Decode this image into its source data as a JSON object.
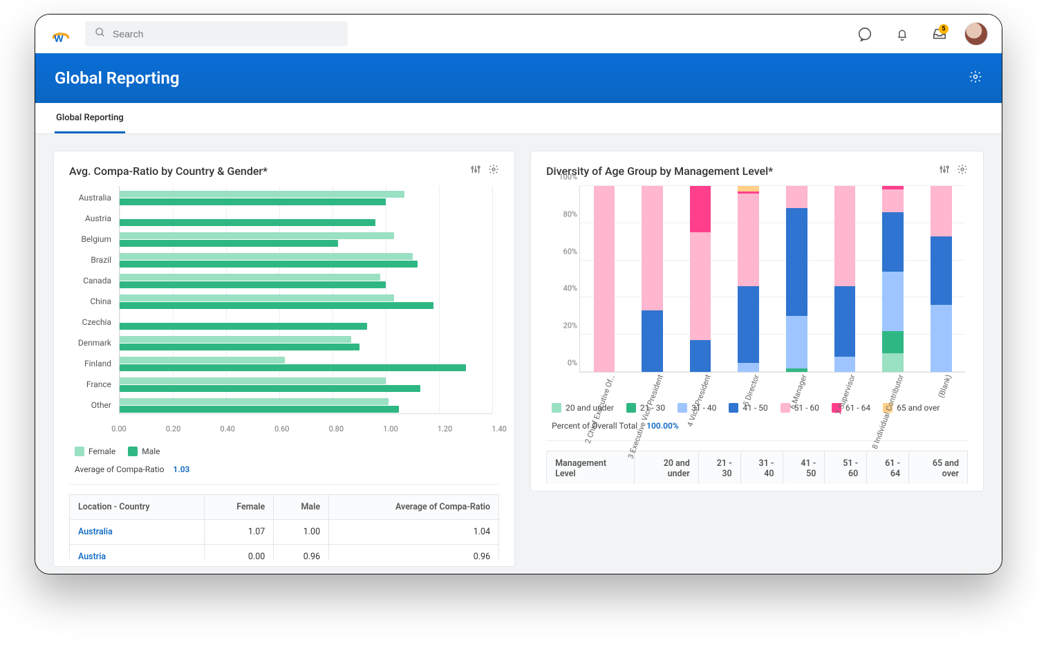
{
  "topbar": {
    "search_placeholder": "Search",
    "inbox_badge": "5"
  },
  "header": {
    "title": "Global Reporting"
  },
  "tabs": [
    "Global Reporting"
  ],
  "left_card": {
    "title": "Avg. Compa-Ratio by Country & Gender*",
    "summary_label": "Average of Compa-Ratio",
    "summary_value": "1.03",
    "legend": [
      "Female",
      "Male"
    ],
    "xticks": [
      "0.00",
      "0.20",
      "0.40",
      "0.60",
      "0.80",
      "1.00",
      "1.20",
      "1.40"
    ],
    "table_headers": [
      "Location - Country",
      "Female",
      "Male",
      "Average of Compa-Ratio"
    ],
    "table_rows": [
      {
        "country": "Australia",
        "female": "1.07",
        "male": "1.00",
        "avg": "1.04"
      },
      {
        "country": "Austria",
        "female": "0.00",
        "male": "0.96",
        "avg": "0.96"
      }
    ]
  },
  "right_card": {
    "title": "Diversity of Age Group by Management Level*",
    "yticks": [
      "0%",
      "20%",
      "40%",
      "60%",
      "80%",
      "100%"
    ],
    "legend": [
      {
        "label": "20 and under",
        "class": "c-20u"
      },
      {
        "label": "21 - 30",
        "class": "c-2130"
      },
      {
        "label": "31 - 40",
        "class": "c-3140"
      },
      {
        "label": "41 - 50",
        "class": "c-4150"
      },
      {
        "label": "51 - 60",
        "class": "c-5160"
      },
      {
        "label": "61 - 64",
        "class": "c-6164"
      },
      {
        "label": "65 and over",
        "class": "c-65o"
      }
    ],
    "summary_label": "Percent of Overall Total",
    "summary_value": "100.00%",
    "table_headers": [
      "Management Level",
      "20 and under",
      "21 - 30",
      "31 - 40",
      "41 - 50",
      "51 - 60",
      "61 - 64",
      "65 and over"
    ]
  },
  "chart_data": [
    {
      "id": "compa_ratio_by_country_gender",
      "type": "bar",
      "orientation": "horizontal",
      "title": "Avg. Compa-Ratio by Country & Gender*",
      "xlabel": "",
      "ylabel": "",
      "xlim": [
        0,
        1.4
      ],
      "xticks": [
        0.0,
        0.2,
        0.4,
        0.6,
        0.8,
        1.0,
        1.2,
        1.4
      ],
      "categories": [
        "Australia",
        "Austria",
        "Belgium",
        "Brazil",
        "Canada",
        "China",
        "Czechia",
        "Denmark",
        "Finland",
        "France",
        "Other"
      ],
      "series": [
        {
          "name": "Female",
          "color": "#9ae0c2",
          "values": [
            1.07,
            0.0,
            1.03,
            1.1,
            0.98,
            1.03,
            0.0,
            0.87,
            0.62,
            1.0,
            1.01
          ]
        },
        {
          "name": "Male",
          "color": "#2fb783",
          "values": [
            1.0,
            0.96,
            0.82,
            1.12,
            1.0,
            1.18,
            0.93,
            0.9,
            1.3,
            1.13,
            1.05
          ]
        }
      ],
      "legend_position": "bottom",
      "summary": {
        "label": "Average of Compa-Ratio",
        "value": 1.03
      }
    },
    {
      "id": "age_group_by_mgmt_level",
      "type": "stacked-bar-100",
      "title": "Diversity of Age Group by Management Level*",
      "ylabel": "",
      "xlabel": "",
      "ylim": [
        0,
        100
      ],
      "yticks": [
        0,
        20,
        40,
        60,
        80,
        100
      ],
      "categories": [
        "2 Chief Executive Of…",
        "3 Executive Vice President",
        "4 Vice President",
        "5 Director",
        "6 Manager",
        "7 Supervisor",
        "8 Individual Contributor",
        "(Blank)"
      ],
      "series": [
        {
          "name": "20 and under",
          "color": "#9ae0c2",
          "values": [
            0,
            0,
            0,
            0,
            0,
            0,
            10,
            0
          ]
        },
        {
          "name": "21 - 30",
          "color": "#2fb783",
          "values": [
            0,
            0,
            0,
            0,
            2,
            0,
            12,
            0
          ]
        },
        {
          "name": "31 - 40",
          "color": "#9ec5ff",
          "values": [
            0,
            0,
            0,
            5,
            28,
            8,
            32,
            36
          ]
        },
        {
          "name": "41 - 50",
          "color": "#2f74d0",
          "values": [
            0,
            33,
            17,
            41,
            58,
            38,
            32,
            37
          ]
        },
        {
          "name": "51 - 60",
          "color": "#ffb6cf",
          "values": [
            100,
            67,
            58,
            50,
            12,
            54,
            12,
            27
          ]
        },
        {
          "name": "61 - 64",
          "color": "#ff3f8c",
          "values": [
            0,
            0,
            25,
            1,
            0,
            0,
            2,
            0
          ]
        },
        {
          "name": "65 and over",
          "color": "#ffcf8a",
          "values": [
            0,
            0,
            0,
            3,
            0,
            0,
            0,
            0
          ]
        }
      ],
      "legend_position": "bottom",
      "summary": {
        "label": "Percent of Overall Total",
        "value": "100.00%"
      }
    }
  ]
}
